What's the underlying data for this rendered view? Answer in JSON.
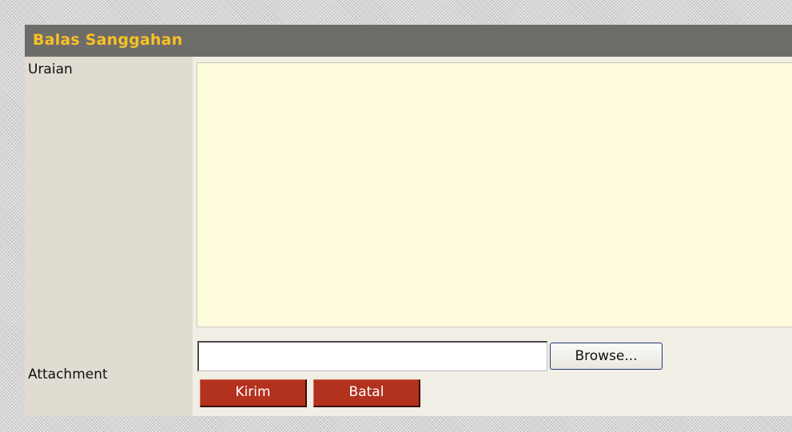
{
  "form": {
    "title": "Balas Sanggahan",
    "fields": {
      "uraian_label": "Uraian",
      "uraian_value": "",
      "attachment_label": "Attachment",
      "attachment_value": "",
      "browse_label": "Browse..."
    },
    "actions": {
      "submit_label": "Kirim",
      "cancel_label": "Batal"
    }
  },
  "colors": {
    "header_bg": "#6e6c68",
    "title_text": "#f7c126",
    "textarea_bg": "#fefcdc",
    "label_column_bg": "#e0dcd2",
    "action_button_bg": "#b3321e"
  }
}
